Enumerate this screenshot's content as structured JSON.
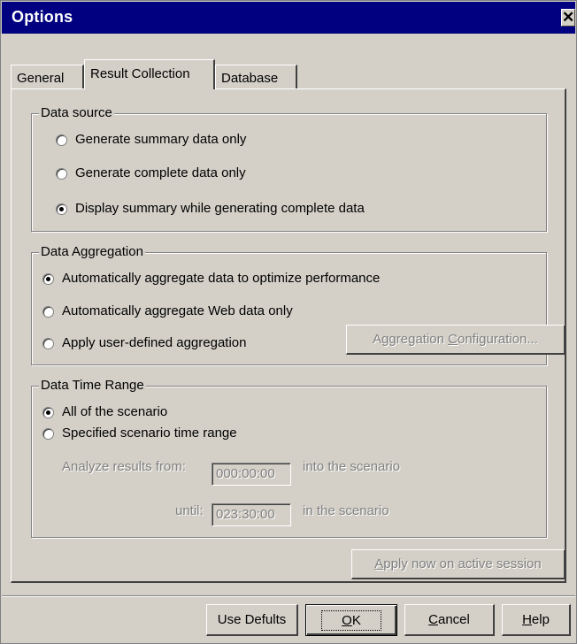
{
  "window": {
    "title": "Options",
    "close_glyph": "✕"
  },
  "tabs": [
    {
      "label": "General",
      "active": false
    },
    {
      "label": "Result Collection",
      "active": true
    },
    {
      "label": "Database",
      "active": false
    }
  ],
  "data_source": {
    "legend": "Data source",
    "options": [
      {
        "label": "Generate summary data only",
        "checked": false
      },
      {
        "label": "Generate complete data only",
        "checked": false
      },
      {
        "label": "Display summary while generating complete data",
        "checked": true
      }
    ]
  },
  "data_aggregation": {
    "legend": "Data Aggregation",
    "options": [
      {
        "label": "Automatically aggregate data to optimize performance",
        "checked": true
      },
      {
        "label": "Automatically aggregate Web data only",
        "checked": false
      },
      {
        "label": "Apply user-defined aggregation",
        "checked": false
      }
    ],
    "config_button": {
      "before": "Aggregation ",
      "mnemonic": "C",
      "after": "onfiguration...",
      "enabled": false
    }
  },
  "data_time_range": {
    "legend": "Data Time Range",
    "options": [
      {
        "label": "All of the scenario",
        "checked": true
      },
      {
        "label": "Specified scenario time range",
        "checked": false
      }
    ],
    "from_label": "Analyze results from:",
    "from_value": "000:00:00",
    "from_suffix": "into the scenario",
    "until_label": "until:",
    "until_value": "023:30:00",
    "until_suffix": "in the scenario"
  },
  "apply_button": {
    "mnemonic": "A",
    "after": "pply now on active session",
    "enabled": false
  },
  "footer": {
    "use_defaults": "Use Defults",
    "ok": {
      "mnemonic": "O",
      "after": "K"
    },
    "cancel": {
      "mnemonic": "C",
      "after": "ancel"
    },
    "help": {
      "mnemonic": "H",
      "after": "elp"
    }
  }
}
